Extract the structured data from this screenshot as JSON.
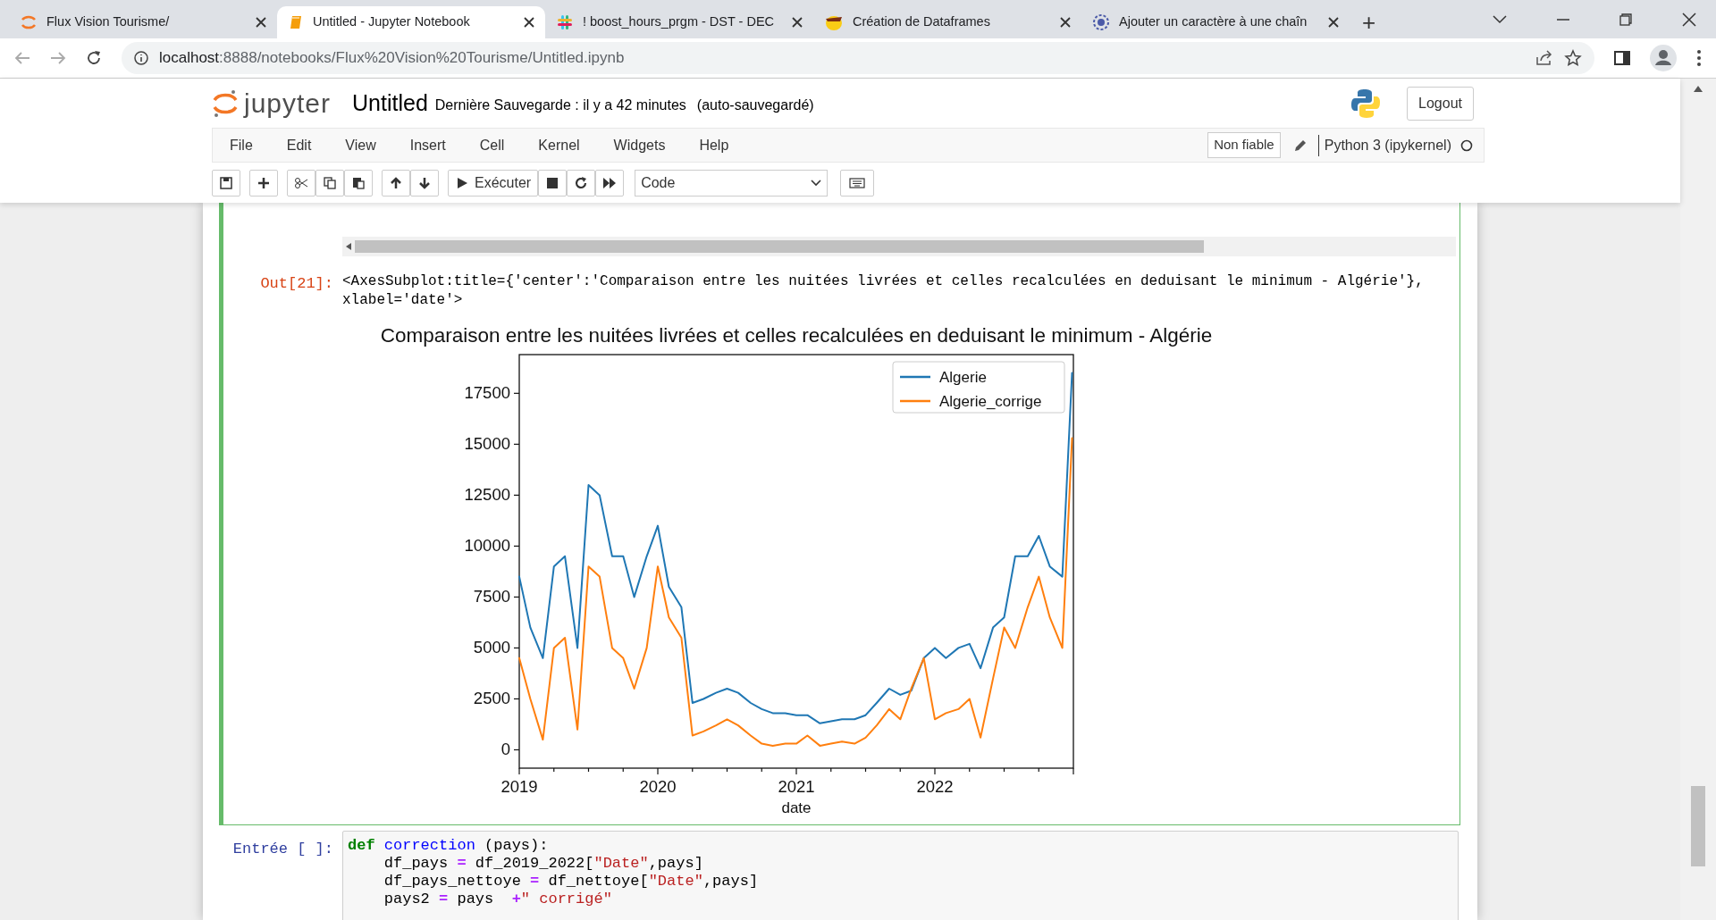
{
  "browser": {
    "tabs": [
      {
        "title": "Flux Vision Tourisme/",
        "kind": "jupyter",
        "selected": false
      },
      {
        "title": "Untitled - Jupyter Notebook",
        "kind": "notebook",
        "selected": true
      },
      {
        "title": "! boost_hours_prgm - DST - DEC",
        "kind": "slack",
        "selected": false
      },
      {
        "title": "Création de Dataframes",
        "kind": "mascot",
        "selected": false
      },
      {
        "title": "Ajouter un caractère à une chaîn",
        "kind": "gear",
        "selected": false
      }
    ],
    "new_tab": "+",
    "url_host": "localhost",
    "url_rest": ":8888/notebooks/Flux%20Vision%20Tourisme/Untitled.ipynb"
  },
  "header": {
    "logo_text": "jupyter",
    "notebook_name": "Untitled",
    "last_saved": "Dernière Sauvegarde : il y a 42 minutes",
    "autosave": "(auto-sauvegardé)",
    "logout": "Logout"
  },
  "menu": {
    "items": [
      "File",
      "Edit",
      "View",
      "Insert",
      "Cell",
      "Kernel",
      "Widgets",
      "Help"
    ],
    "trust": "Non fiable",
    "kernel": "Python 3 (ipykernel)"
  },
  "toolbar": {
    "buttons": [
      {
        "kind": "save"
      },
      {
        "kind": "add"
      },
      {
        "kind": "cut"
      },
      {
        "kind": "copy"
      },
      {
        "kind": "paste"
      },
      {
        "kind": "up"
      },
      {
        "kind": "down"
      },
      {
        "kind": "run",
        "label": "Exécuter"
      },
      {
        "kind": "stop"
      },
      {
        "kind": "restart"
      },
      {
        "kind": "fastforward"
      }
    ],
    "cell_type": "Code"
  },
  "output": {
    "prompt": "Out[21]:",
    "text_lines": [
      "<AxesSubplot:title={'center':'Comparaison entre les nuitées livrées et celles recalculées en deduisant le minimum - Algérie'},",
      "xlabel='date'>"
    ],
    "chart_data": {
      "type": "line",
      "title": "Comparaison entre les nuitées livrées et celles recalculées en deduisant le minimum - Algérie",
      "xlabel": "date",
      "x": [
        2019.0,
        2019.08,
        2019.17,
        2019.25,
        2019.33,
        2019.42,
        2019.5,
        2019.58,
        2019.67,
        2019.75,
        2019.83,
        2019.92,
        2020.0,
        2020.08,
        2020.17,
        2020.25,
        2020.33,
        2020.42,
        2020.5,
        2020.58,
        2020.67,
        2020.75,
        2020.83,
        2020.92,
        2021.0,
        2021.08,
        2021.17,
        2021.25,
        2021.33,
        2021.42,
        2021.5,
        2021.58,
        2021.67,
        2021.75,
        2021.83,
        2021.92,
        2022.0,
        2022.08,
        2022.17,
        2022.25,
        2022.33,
        2022.42,
        2022.5,
        2022.58,
        2022.67,
        2022.75,
        2022.83,
        2022.92,
        2022.99
      ],
      "series": [
        {
          "name": "Algerie",
          "color": "#1f77b4",
          "values": [
            8500,
            6000,
            4500,
            9000,
            9500,
            5000,
            13000,
            12500,
            9500,
            9500,
            7500,
            9500,
            11000,
            8000,
            7000,
            2300,
            2500,
            2800,
            3000,
            2800,
            2300,
            2000,
            1800,
            1800,
            1700,
            1700,
            1300,
            1400,
            1500,
            1500,
            1700,
            2300,
            3000,
            2700,
            2900,
            4500,
            5000,
            4500,
            5000,
            5200,
            4000,
            6000,
            6500,
            9500,
            9500,
            10500,
            9000,
            8500,
            18500
          ]
        },
        {
          "name": "Algerie_corrige",
          "color": "#ff7f0e",
          "values": [
            4500,
            2500,
            500,
            5000,
            5500,
            1000,
            9000,
            8500,
            5000,
            4500,
            3000,
            5000,
            9000,
            6500,
            5500,
            700,
            900,
            1200,
            1500,
            1200,
            700,
            300,
            200,
            300,
            300,
            700,
            200,
            300,
            400,
            300,
            600,
            1200,
            2000,
            1500,
            3000,
            4500,
            1500,
            1800,
            2000,
            2500,
            600,
            3500,
            6000,
            5000,
            7000,
            8500,
            6500,
            5000,
            15300
          ]
        }
      ],
      "legend": true,
      "xlim": [
        2019,
        2023
      ],
      "ylim": [
        -900,
        19400
      ],
      "xticks": [
        {
          "value": 2019,
          "label": "2019"
        },
        {
          "value": 2020,
          "label": "2020"
        },
        {
          "value": 2021,
          "label": "2021"
        },
        {
          "value": 2022,
          "label": "2022"
        }
      ],
      "yticks": [
        0,
        2500,
        5000,
        7500,
        10000,
        12500,
        15000,
        17500
      ]
    }
  },
  "next_cell": {
    "prompt": "Entrée [ ]:",
    "lines": [
      [
        {
          "kind": "keyword",
          "text": "def"
        },
        {
          "kind": "function",
          "text": " correction"
        },
        {
          "kind": "plain",
          "text": " (pays):"
        }
      ],
      [
        {
          "kind": "plain",
          "text": "    df_pays "
        },
        {
          "kind": "operator",
          "text": "="
        },
        {
          "kind": "plain",
          "text": " df_2019_2022["
        },
        {
          "kind": "string",
          "text": "\"Date\""
        },
        {
          "kind": "plain",
          "text": ",pays]"
        }
      ],
      [
        {
          "kind": "plain",
          "text": "    df_pays_nettoye "
        },
        {
          "kind": "operator",
          "text": "="
        },
        {
          "kind": "plain",
          "text": " df_nettoye["
        },
        {
          "kind": "string",
          "text": "\"Date\""
        },
        {
          "kind": "plain",
          "text": ",pays]"
        }
      ],
      [
        {
          "kind": "plain",
          "text": "    pays2 "
        },
        {
          "kind": "operator",
          "text": "="
        },
        {
          "kind": "plain",
          "text": " pays  "
        },
        {
          "kind": "operator",
          "text": "+"
        },
        {
          "kind": "string",
          "text": "\" corrigé\""
        }
      ]
    ]
  }
}
